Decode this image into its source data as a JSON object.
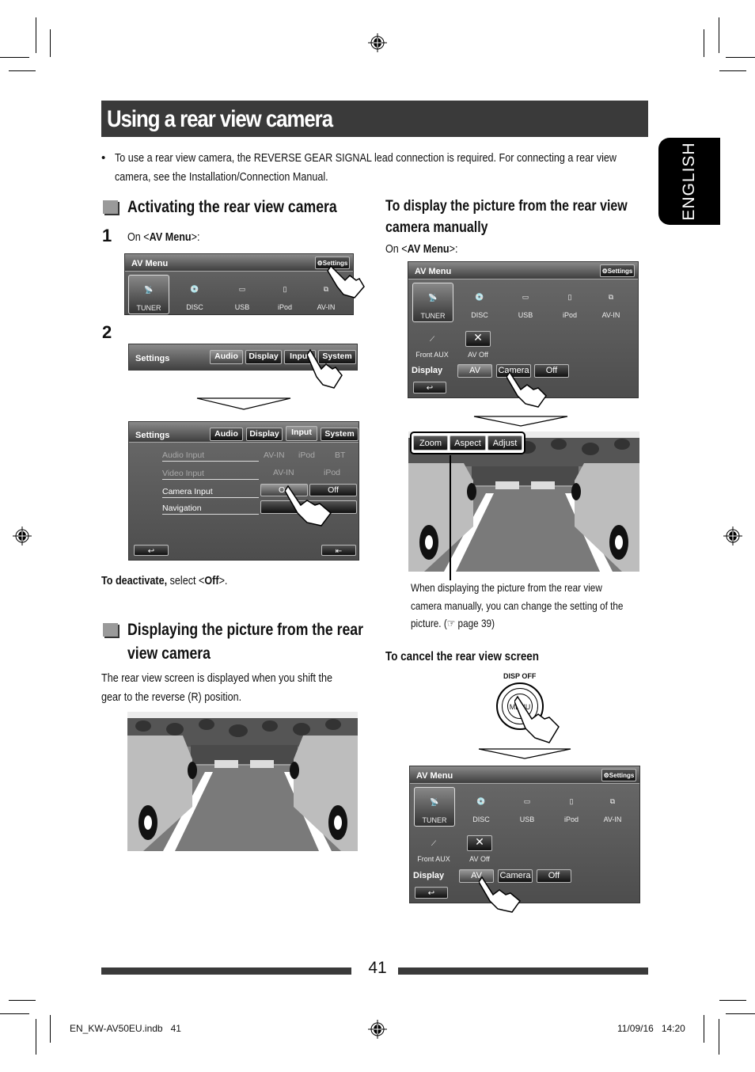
{
  "page": {
    "title": "Using a rear view camera",
    "language_tab": "ENGLISH",
    "intro_bullet": "To use a rear view camera, the REVERSE GEAR SIGNAL lead connection is required. For connecting a rear view camera, see the Installation/Connection Manual.",
    "page_number": "41",
    "footer_left": "EN_KW-AV50EU.indb   41",
    "footer_right": "11/09/16   14:20"
  },
  "activating": {
    "heading": "Activating the rear view camera",
    "step1_num": "1",
    "step1_pre": "On <",
    "step1_bold": "AV Menu",
    "step1_post": ">:",
    "step2_num": "2",
    "deactivate_bold": "To deactivate,",
    "deactivate_mid": " select <",
    "deactivate_off": "Off",
    "deactivate_end": ">."
  },
  "displaying": {
    "heading_line1": "Displaying the picture from the rear",
    "heading_line2": "view camera",
    "body_line1": "The rear view screen is displayed when you shift the",
    "body_line2": "gear to the reverse (R) position."
  },
  "manual": {
    "heading_line1": "To display the picture from the rear view",
    "heading_line2": "camera manually",
    "on_pre": "On <",
    "on_bold": "AV Menu",
    "on_post": ">:",
    "note_line1": "When displaying the picture from the rear view",
    "note_line2": "camera manually, you can change the setting of the",
    "note_line3": "picture. (☞ page 39)"
  },
  "cancel": {
    "heading": "To cancel the rear view screen",
    "button_top_label": "DISP OFF",
    "button_label": "MENU"
  },
  "av_menu": {
    "title": "AV Menu",
    "settings_label": "Settings",
    "sources": [
      "TUNER",
      "DISC",
      "USB",
      "iPod",
      "AV-IN"
    ],
    "extra": [
      "Front AUX",
      "AV Off"
    ],
    "display_label": "Display",
    "display_options": [
      "AV",
      "Camera",
      "Off"
    ]
  },
  "settings_screen": {
    "title": "Settings",
    "tabs": [
      "Audio",
      "Display",
      "Input",
      "System"
    ],
    "rows": [
      {
        "label": "Audio Input",
        "options": [
          "AV-IN",
          "iPod",
          "BT"
        ]
      },
      {
        "label": "Video Input",
        "options": [
          "AV-IN",
          "iPod"
        ]
      },
      {
        "label": "Camera Input",
        "options": [
          "On",
          "Off"
        ]
      },
      {
        "label": "Navigation",
        "options": []
      }
    ]
  },
  "camera_overlay": {
    "buttons": [
      "Zoom",
      "Aspect",
      "Adjust"
    ]
  }
}
